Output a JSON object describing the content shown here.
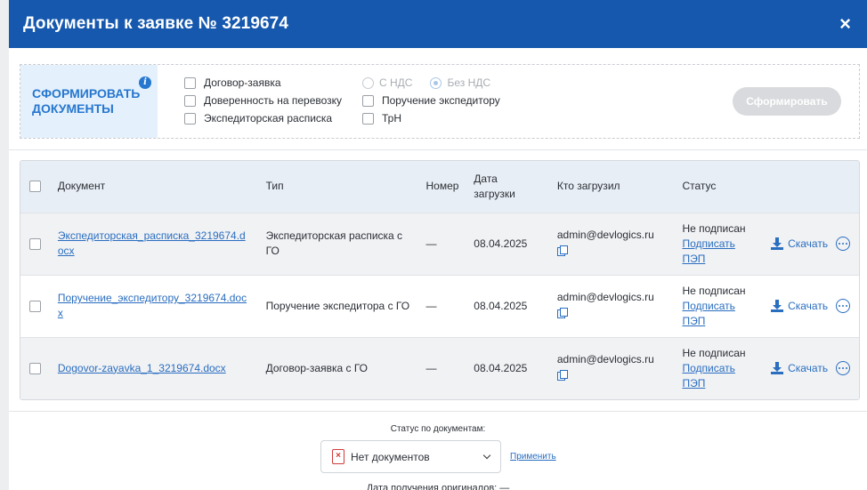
{
  "modal": {
    "title": "Документы к заявке № 3219674",
    "close_label": "×"
  },
  "generate": {
    "title": "СФОРМИРОВАТЬ ДОКУМЕНТЫ",
    "info": "i",
    "checkboxes_col1": [
      "Договор-заявка",
      "Доверенность на перевозку",
      "Экспедиторская расписка"
    ],
    "radio_options": [
      "С НДС",
      "Без НДС"
    ],
    "radio_selected": "Без НДС",
    "checkboxes_col2": [
      "Поручение экспедитору",
      "ТрН"
    ],
    "button_label": "Сформировать"
  },
  "table": {
    "headers": {
      "document": "Документ",
      "type": "Тип",
      "number": "Номер",
      "date": "Дата загрузки",
      "uploaded_by": "Кто загрузил",
      "status": "Статус"
    },
    "rows": [
      {
        "document": "Экспедиторская_расписка_3219674.docx",
        "type": "Экспедиторская расписка с ГО",
        "number": "—",
        "date": "08.04.2025",
        "uploaded_by": "admin@devlogics.ru",
        "status": "Не подписан",
        "sign_link": "Подписать ПЭП",
        "download": "Скачать"
      },
      {
        "document": "Поручение_экспедитору_3219674.docx",
        "type": "Поручение экспедитора с ГО",
        "number": "—",
        "date": "08.04.2025",
        "uploaded_by": "admin@devlogics.ru",
        "status": "Не подписан",
        "sign_link": "Подписать ПЭП",
        "download": "Скачать"
      },
      {
        "document": "Dogovor-zayavka_1_3219674.docx",
        "type": "Договор-заявка с ГО",
        "number": "—",
        "date": "08.04.2025",
        "uploaded_by": "admin@devlogics.ru",
        "status": "Не подписан",
        "sign_link": "Подписать ПЭП",
        "download": "Скачать"
      }
    ]
  },
  "footer": {
    "status_label": "Статус по документам:",
    "status_value": "Нет документов",
    "apply_label": "Применить",
    "originals_label": "Дата получения оригиналов: —"
  },
  "colors": {
    "header_bg": "#1558ae",
    "accent": "#2a6ec0",
    "panel_bg": "#e4f0fb"
  }
}
